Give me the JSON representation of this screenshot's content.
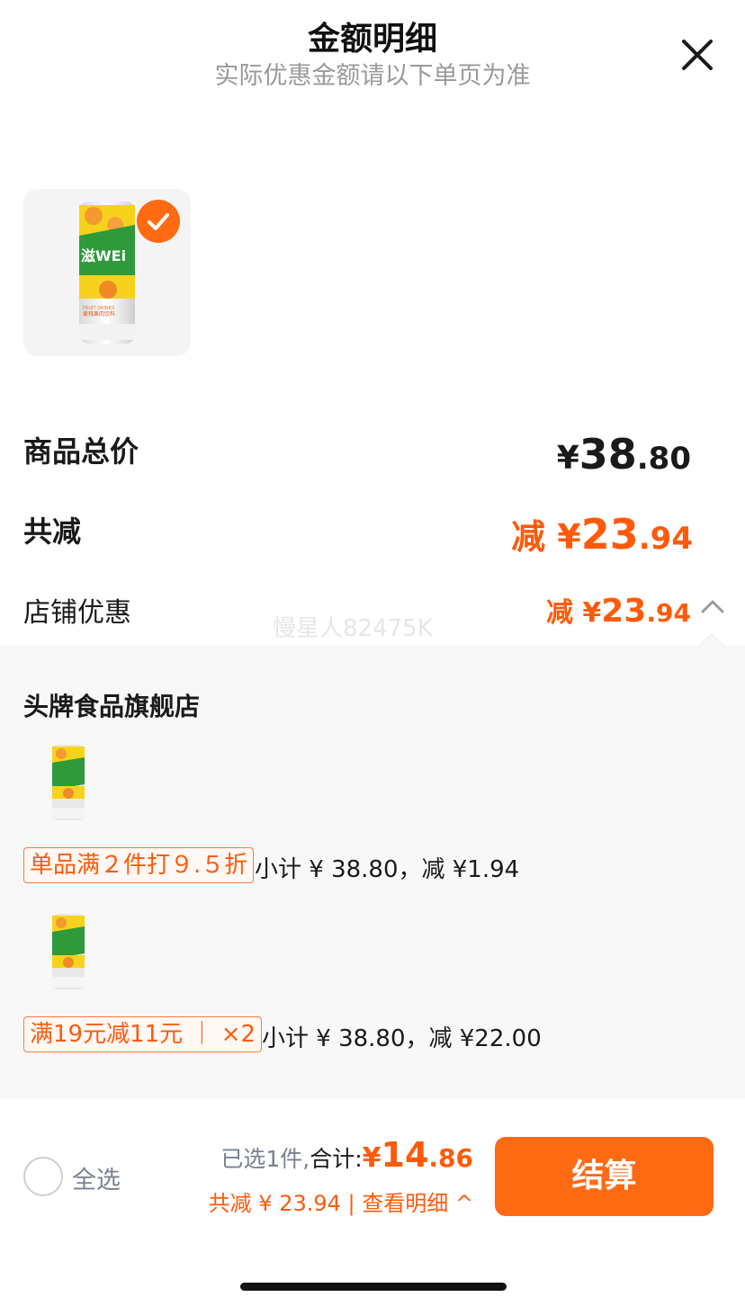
{
  "header": {
    "title": "金额明细",
    "subtitle": "实际优惠金额请以下单页为准"
  },
  "product": {
    "can_brand": "滋WEi",
    "can_caption": "FRUIT DRINKS",
    "can_product_name": "黄桃果肉饮料",
    "checked": true
  },
  "summary": {
    "total_label": "商品总价",
    "total_yen": "¥",
    "total_int": "38",
    "total_dec": ".80",
    "reduce_label": "共减",
    "reduce_prefix": "减 ¥",
    "reduce_int": "23",
    "reduce_dec": ".94",
    "shop_label": "店铺优惠",
    "shop_prefix": "减 ¥",
    "shop_int": "23",
    "shop_dec": ".94"
  },
  "watermark": "慢星人82475K",
  "panel": {
    "store_name": "头牌食品旗舰店",
    "promos": [
      {
        "tag": "单品满２件打９.５折",
        "text": "小计 ¥ 38.80，减 ¥1.94"
      },
      {
        "tag": "满19元减11元 ｜ ×2",
        "text": "小计 ¥ 38.80，减 ¥22.00"
      }
    ]
  },
  "bottom": {
    "select_all": "全选",
    "selected_count": "已选1件,",
    "total_label": "合计:",
    "total_yen": "¥",
    "total_int": "14",
    "total_dec": ".86",
    "reduce_summary": "共减 ¥ 23.94 | 查看明细 ^",
    "checkout": "结算"
  },
  "colors": {
    "accent": "#ff6a13",
    "discount_text": "#ff5a0a",
    "panel_bg": "#f8f8f8"
  }
}
